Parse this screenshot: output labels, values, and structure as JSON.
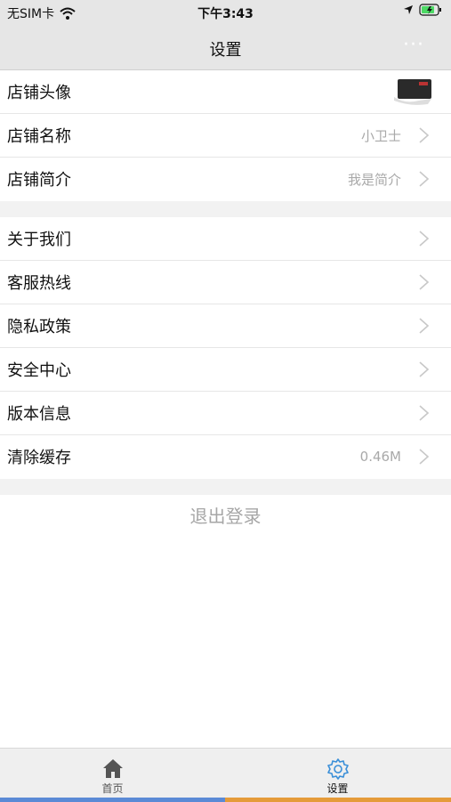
{
  "status": {
    "carrier": "无SIM卡",
    "time": "下午3:43"
  },
  "nav": {
    "title": "设置",
    "more": "···"
  },
  "group1": [
    {
      "label": "店铺头像",
      "value": ""
    },
    {
      "label": "店铺名称",
      "value": "小卫士"
    },
    {
      "label": "店铺简介",
      "value": "我是简介"
    }
  ],
  "group2": [
    {
      "label": "关于我们",
      "value": ""
    },
    {
      "label": "客服热线",
      "value": ""
    },
    {
      "label": "隐私政策",
      "value": ""
    },
    {
      "label": "安全中心",
      "value": ""
    },
    {
      "label": "版本信息",
      "value": ""
    },
    {
      "label": "清除缓存",
      "value": "0.46M"
    }
  ],
  "logout": "退出登录",
  "tabs": [
    {
      "label": "首页",
      "icon": "home-icon"
    },
    {
      "label": "设置",
      "icon": "gear-icon"
    }
  ],
  "colors": {
    "home_tab_bar": "#5b8ad6",
    "settings_tab_bar": "#e59b3a"
  }
}
